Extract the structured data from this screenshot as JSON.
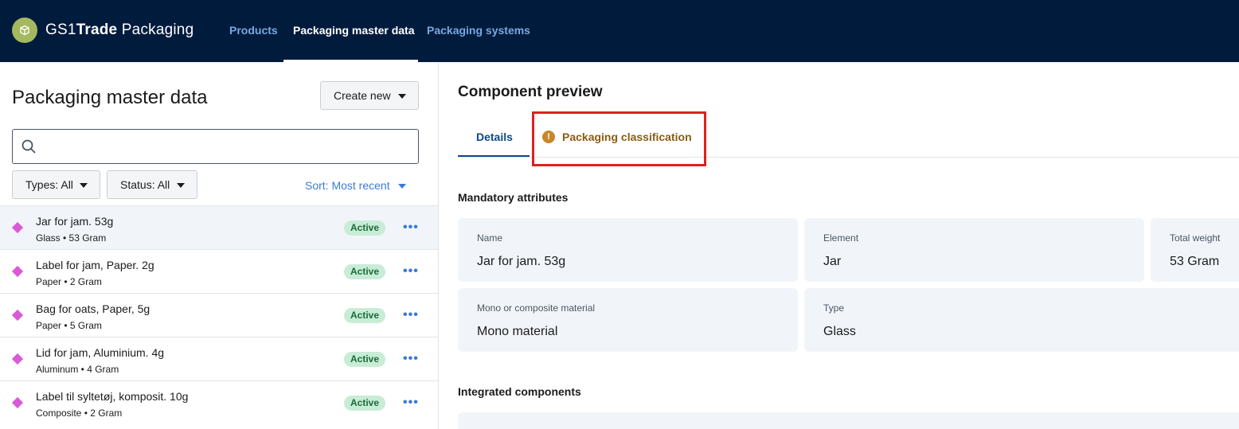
{
  "header": {
    "brand_prefix": "GS1",
    "brand_bold": "Trade",
    "brand_suffix": " Packaging",
    "nav": [
      {
        "label": "Products"
      },
      {
        "label": "Packaging master data"
      },
      {
        "label": "Packaging systems"
      }
    ],
    "active_nav": "Packaging master data"
  },
  "left": {
    "title": "Packaging master data",
    "create_label": "Create new",
    "search_placeholder": "",
    "filters": {
      "types": "Types: All",
      "status": "Status: All",
      "sort": "Sort: Most recent"
    },
    "items": [
      {
        "title": "Jar for jam. 53g",
        "sub": "Glass • 53 Gram",
        "status": "Active",
        "more": "•••"
      },
      {
        "title": "Label for jam, Paper. 2g",
        "sub": "Paper • 2 Gram",
        "status": "Active",
        "more": "•••"
      },
      {
        "title": "Bag for oats, Paper, 5g",
        "sub": "Paper • 5 Gram",
        "status": "Active",
        "more": "•••"
      },
      {
        "title": "Lid for jam, Aluminium. 4g",
        "sub": "Aluminum • 4 Gram",
        "status": "Active",
        "more": "•••"
      },
      {
        "title": "Label til syltetøj, komposit. 10g",
        "sub": "Composite • 2 Gram",
        "status": "Active",
        "more": "•••"
      }
    ]
  },
  "right": {
    "title": "Component preview",
    "tabs": {
      "details": "Details",
      "classification": "Packaging classification",
      "classification_icon": "!"
    },
    "mandatory_label": "Mandatory attributes",
    "attributes": {
      "name": {
        "label": "Name",
        "value": "Jar for jam. 53g"
      },
      "element": {
        "label": "Element",
        "value": "Jar"
      },
      "weight": {
        "label": "Total weight",
        "value": "53 Gram"
      },
      "material": {
        "label": "Mono or composite material",
        "value": "Mono material"
      },
      "type": {
        "label": "Type",
        "value": "Glass"
      }
    },
    "integrated_label": "Integrated components"
  },
  "colors": {
    "topbar": "#011b3d",
    "accent": "#3a7bd5",
    "status_active_bg": "#c9ecd6",
    "warning": "#c8872a",
    "highlight": "#e02020"
  }
}
